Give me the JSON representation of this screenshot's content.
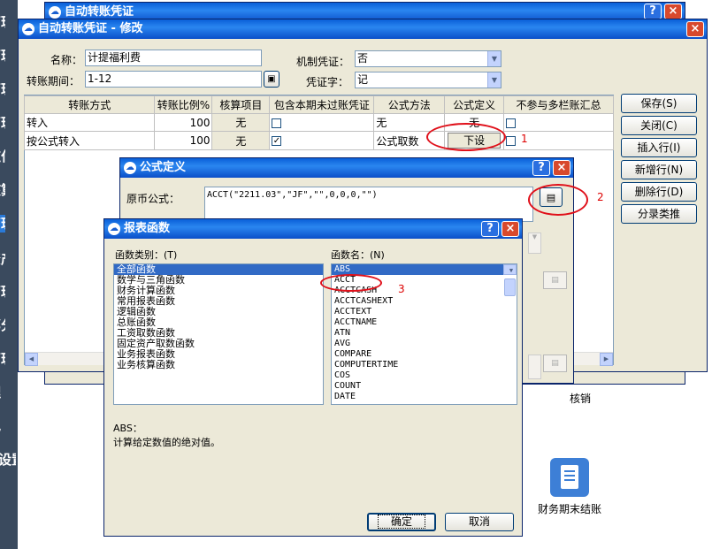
{
  "sidebar": {
    "items": [
      "管理",
      "管理",
      "管理",
      "管理",
      "应付",
      "核算",
      "管理",
      "资产",
      "管理",
      "部分",
      "管理",
      "理",
      "记",
      "设置"
    ]
  },
  "back_window": {
    "title": "自动转账凭证",
    "close": "×",
    "help": "?"
  },
  "main_window": {
    "title": "自动转账凭证 - 修改",
    "close": "×",
    "name_label": "名称：",
    "name_value": "计提福利费",
    "period_label": "转账期间：",
    "period_value": "1-12",
    "machine_label": "机制凭证：",
    "machine_value": "否",
    "voucher_label": "凭证字：",
    "voucher_value": "记",
    "columns": [
      "转账方式",
      "转账比例%",
      "核算项目",
      "包含本期未过账凭证",
      "公式方法",
      "公式定义",
      "不参与多栏账汇总"
    ],
    "rows": [
      {
        "method": "转入",
        "ratio": "100",
        "item": "无",
        "include": "",
        "formula_method": "无",
        "formula_def": "无",
        "exclude": ""
      },
      {
        "method": "按公式转入",
        "ratio": "100",
        "item": "无",
        "include": "✓",
        "formula_method": "公式取数",
        "formula_def": "下设",
        "exclude": ""
      }
    ],
    "buttons": [
      "保存(S)",
      "关闭(C)",
      "插入行(I)",
      "新增行(N)",
      "删除行(D)",
      "分录类推"
    ]
  },
  "formula_window": {
    "title": "公式定义",
    "help": "?",
    "close": "×",
    "source_label": "原币公式：",
    "source_value": "ACCT(\"2211.03\",\"JF\",\"\",0,0,0,\"\")"
  },
  "func_window": {
    "title": "报表函数",
    "help": "?",
    "close": "×",
    "category_label": "函数类别：(T)",
    "name_label": "函数名：(N)",
    "categories": [
      "全部函数",
      "数学与三角函数",
      "财务计算函数",
      "常用报表函数",
      "逻辑函数",
      "总账函数",
      "工资取数函数",
      "固定资产取数函数",
      "业务报表函数",
      "业务核算函数"
    ],
    "functions": [
      "ABS",
      "ACCT",
      "ACCTCASH",
      "ACCTCASHEXT",
      "ACCTEXT",
      "ACCTNAME",
      "ATN",
      "AVG",
      "COMPARE",
      "COMPUTERTIME",
      "COS",
      "COUNT",
      "DATE"
    ],
    "desc_title": "ABS：",
    "desc_text": "计算给定数值的绝对值。",
    "ok": "确定",
    "cancel": "取消"
  },
  "annotations": [
    "1",
    "2",
    "3"
  ],
  "desktop_icons": [
    {
      "label": "核销"
    },
    {
      "label": "财务期末结账"
    }
  ]
}
